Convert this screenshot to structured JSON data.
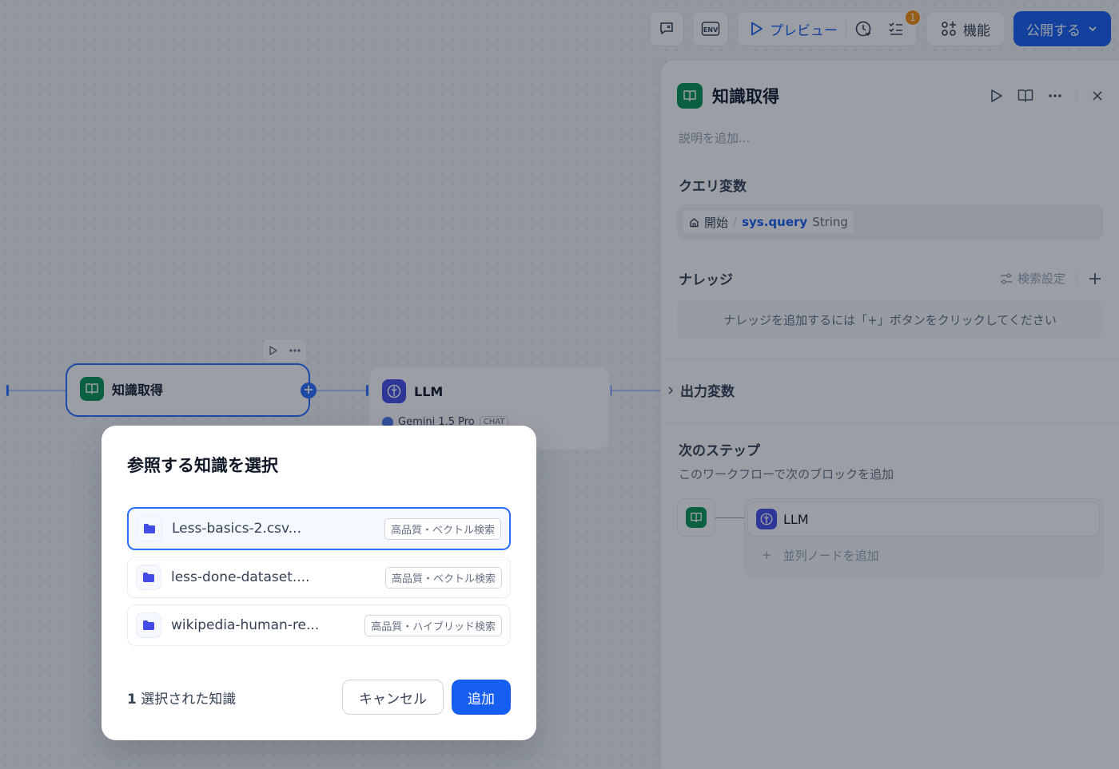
{
  "toolbar": {
    "preview_label": "プレビュー",
    "features_label": "機能",
    "publish_label": "公開する",
    "checklist_badge": "1",
    "env_icon_text": "ENV"
  },
  "canvas": {
    "node_knowledge_title": "知識取得",
    "node_llm_title": "LLM",
    "node_llm_model": "Gemini 1.5 Pro",
    "node_llm_mode": "CHAT"
  },
  "panel": {
    "title": "知識取得",
    "description_placeholder": "説明を追加...",
    "query_section": "クエリ変数",
    "query_source": "開始",
    "query_var": "sys.query",
    "query_type": "String",
    "knowledge_section": "ナレッジ",
    "retrieval_settings": "検索設定",
    "knowledge_empty": "ナレッジを追加するには「+」ボタンをクリックしてください",
    "output_section": "出力変数",
    "next_section": "次のステップ",
    "next_desc": "このワークフローで次のブロックを追加",
    "next_node": "LLM",
    "add_parallel": "並列ノードを追加"
  },
  "modal": {
    "title": "参照する知識を選択",
    "items": [
      {
        "name": "Less-basics-2.csv...",
        "tag": "高品質・ベクトル検索",
        "selected": true
      },
      {
        "name": "less-done-dataset....",
        "tag": "高品質・ベクトル検索",
        "selected": false
      },
      {
        "name": "wikipedia-human-re...",
        "tag": "高品質・ハイブリッド検索",
        "selected": false
      }
    ],
    "selected_count": "1",
    "selected_label": "選択された知識",
    "cancel_label": "キャンセル",
    "add_label": "追加"
  },
  "colors": {
    "accent": "#155eef",
    "knowledge_icon": "#079455",
    "llm_icon": "#444ce7",
    "badge": "#f79009"
  }
}
